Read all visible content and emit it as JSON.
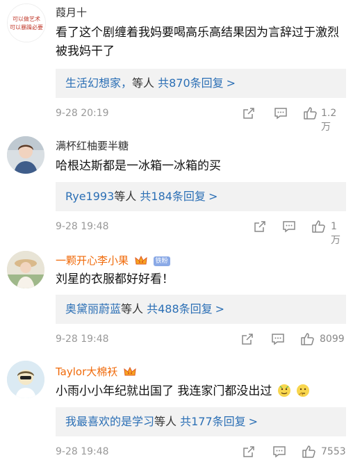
{
  "comments": [
    {
      "username": "葭月十",
      "text": "看了这个剧缠着我妈要喝高乐高结果因为言辞过于激烈被我妈干了",
      "reply_users": "生活幻想家，",
      "reply_etc": "等人",
      "reply_count": "共870条回复",
      "arrow": ">",
      "date": "9-28 20:19",
      "likes": "1.2万",
      "avatar_text_line1": "可以做艺术",
      "avatar_text_line2": "可以暴躁必要"
    },
    {
      "username": "满杯红柚要半糖",
      "text": "哈根达斯都是一冰箱一冰箱的买",
      "reply_users": "Rye1993",
      "reply_etc": "等人",
      "reply_count": "共184条回复",
      "arrow": ">",
      "date": "9-28 19:48",
      "likes": "1万"
    },
    {
      "username": "一颗开心李小果",
      "fan_badge": "铁粉",
      "text": "刘星的衣服都好好看！",
      "reply_users": "奥黛丽蔚蓝",
      "reply_etc": "等人",
      "reply_count": "共488条回复",
      "arrow": ">",
      "date": "9-28 19:48",
      "likes": "8099"
    },
    {
      "username": "Taylor大棉袄",
      "text": "小雨小小年纪就出国了 我连家门都没出过",
      "reply_users": "我最喜欢的是学习",
      "reply_etc": "等人",
      "reply_count": "共177条回复",
      "arrow": ">",
      "date": "9-28 19:48",
      "likes": "7553"
    }
  ],
  "colors": {
    "vip_name": "#f06a0a",
    "link": "#2b6fb5",
    "reply_bg": "#f2f2f2",
    "meta_gray": "#999999"
  },
  "icons": [
    "share-icon",
    "comment-icon",
    "like-icon",
    "vip-crown-icon",
    "emoji-icon"
  ]
}
